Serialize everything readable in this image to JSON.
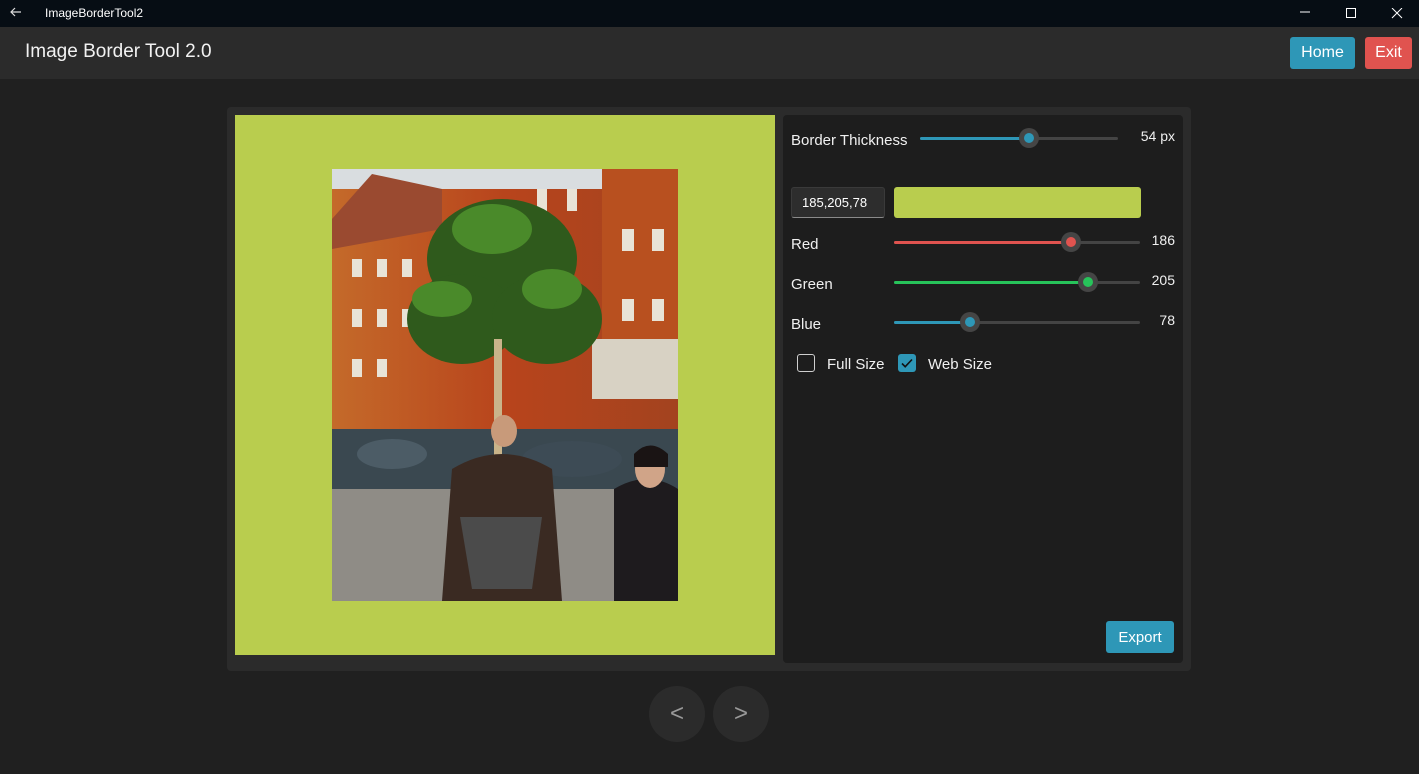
{
  "window": {
    "app_name": "ImageBorderTool2"
  },
  "header": {
    "title": "Image Border Tool 2.0",
    "home_label": "Home",
    "exit_label": "Exit"
  },
  "preview": {
    "border_color": "#b9cd4e"
  },
  "controls": {
    "border_thickness": {
      "label": "Border Thickness",
      "value_text": "54 px",
      "fraction": 0.55
    },
    "rgb_input_value": "185,205,78",
    "swatch_color": "#b9cd4e",
    "red": {
      "label": "Red",
      "value": "186",
      "fraction": 0.72,
      "color": "#e0534f"
    },
    "green": {
      "label": "Green",
      "value": "205",
      "fraction": 0.79,
      "color": "#27c35a"
    },
    "blue": {
      "label": "Blue",
      "value": "78",
      "fraction": 0.31,
      "color": "#2e97b7"
    },
    "full_size": {
      "label": "Full Size",
      "checked": false
    },
    "web_size": {
      "label": "Web Size",
      "checked": true
    },
    "export_label": "Export"
  },
  "nav": {
    "prev_label": "<",
    "next_label": ">"
  }
}
